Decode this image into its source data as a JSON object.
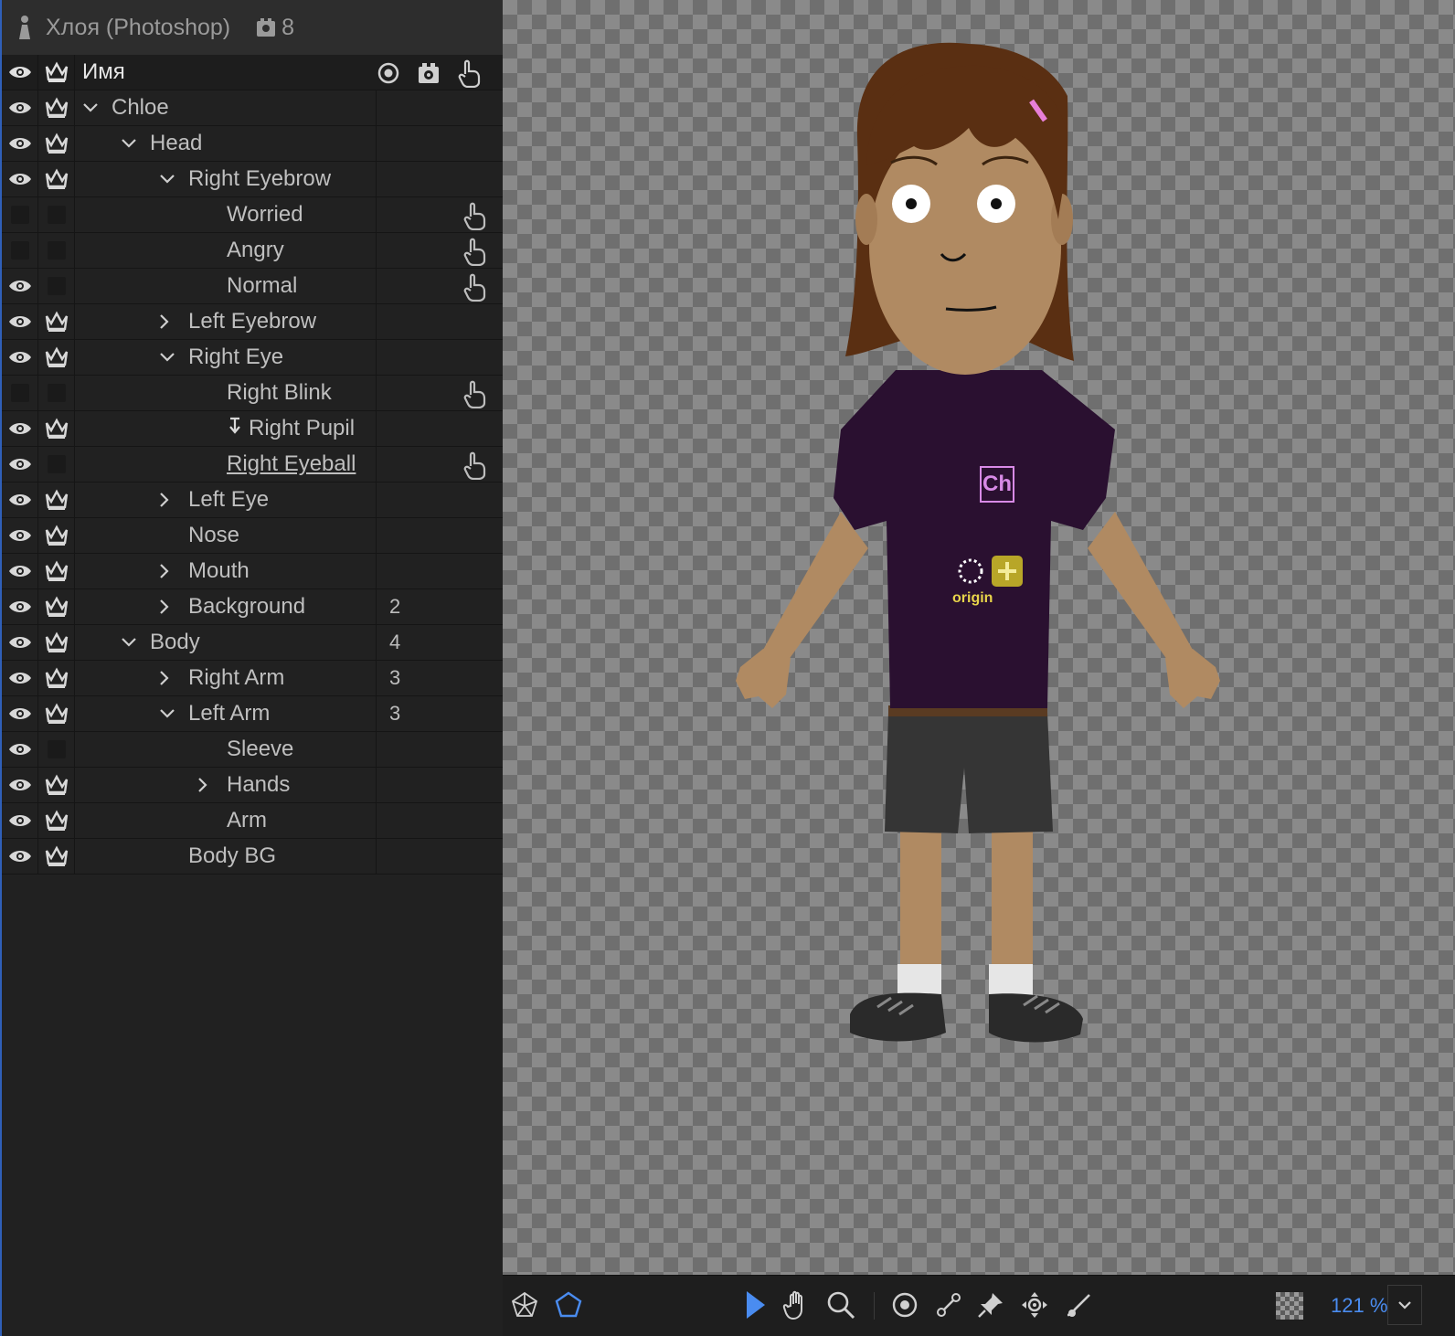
{
  "header": {
    "title": "Хлоя (Photoshop)",
    "count": "8"
  },
  "columns": {
    "name": "Имя"
  },
  "rows": [
    {
      "label": "Chloe",
      "indent": 0,
      "chevron": "down",
      "eye": true,
      "crown": true,
      "num": "",
      "handle": false
    },
    {
      "label": "Head",
      "indent": 1,
      "chevron": "down",
      "eye": true,
      "crown": true,
      "num": "",
      "handle": false
    },
    {
      "label": "Right Eyebrow",
      "indent": 2,
      "chevron": "down",
      "eye": true,
      "crown": true,
      "num": "",
      "handle": false
    },
    {
      "label": "Worried",
      "indent": 3,
      "chevron": "",
      "eye": false,
      "crown": false,
      "num": "",
      "handle": true
    },
    {
      "label": "Angry",
      "indent": 3,
      "chevron": "",
      "eye": false,
      "crown": false,
      "num": "",
      "handle": true
    },
    {
      "label": "Normal",
      "indent": 3,
      "chevron": "",
      "eye": true,
      "crown": false,
      "num": "",
      "handle": true
    },
    {
      "label": "Left Eyebrow",
      "indent": 2,
      "chevron": "right",
      "eye": true,
      "crown": true,
      "num": "",
      "handle": false
    },
    {
      "label": "Right Eye",
      "indent": 2,
      "chevron": "down",
      "eye": true,
      "crown": true,
      "num": "",
      "handle": false
    },
    {
      "label": "Right Blink",
      "indent": 3,
      "chevron": "",
      "eye": false,
      "crown": false,
      "num": "",
      "handle": true
    },
    {
      "label": "Right Pupil",
      "indent": 3,
      "chevron": "",
      "eye": true,
      "crown": true,
      "num": "",
      "handle": false,
      "arrow": true
    },
    {
      "label": "Right Eyeball",
      "indent": 3,
      "chevron": "",
      "eye": true,
      "crown": false,
      "num": "",
      "handle": true,
      "underline": true
    },
    {
      "label": "Left Eye",
      "indent": 2,
      "chevron": "right",
      "eye": true,
      "crown": true,
      "num": "",
      "handle": false
    },
    {
      "label": "Nose",
      "indent": 2,
      "chevron": "",
      "eye": true,
      "crown": true,
      "num": "",
      "handle": false
    },
    {
      "label": "Mouth",
      "indent": 2,
      "chevron": "right",
      "eye": true,
      "crown": true,
      "num": "",
      "handle": false
    },
    {
      "label": "Background",
      "indent": 2,
      "chevron": "right",
      "eye": true,
      "crown": true,
      "num": "2",
      "handle": false
    },
    {
      "label": "Body",
      "indent": 1,
      "chevron": "down",
      "eye": true,
      "crown": true,
      "num": "4",
      "handle": false
    },
    {
      "label": "Right Arm",
      "indent": 2,
      "chevron": "right",
      "eye": true,
      "crown": true,
      "num": "3",
      "handle": false
    },
    {
      "label": "Left Arm",
      "indent": 2,
      "chevron": "down",
      "eye": true,
      "crown": true,
      "num": "3",
      "handle": false
    },
    {
      "label": "Sleeve",
      "indent": 3,
      "chevron": "",
      "eye": true,
      "crown": false,
      "num": "",
      "handle": false
    },
    {
      "label": "Hands",
      "indent": 3,
      "chevron": "right",
      "eye": true,
      "crown": true,
      "num": "",
      "handle": false
    },
    {
      "label": "Arm",
      "indent": 3,
      "chevron": "",
      "eye": true,
      "crown": true,
      "num": "",
      "handle": false
    },
    {
      "label": "Body BG",
      "indent": 2,
      "chevron": "",
      "eye": true,
      "crown": true,
      "num": "",
      "handle": false
    }
  ],
  "canvas": {
    "badge": "Ch",
    "origin_label": "origin"
  },
  "toolbar": {
    "tools": [
      "mesh-tool-icon",
      "polygon-tool-icon",
      "select-arrow-icon",
      "hand-icon",
      "zoom-icon",
      "origin-tool-icon",
      "stick-tool-icon",
      "pin-tool-icon",
      "dragger-tool-icon",
      "draw-tool-icon"
    ],
    "zoom": "121 %"
  },
  "colors": {
    "accent": "#4a8cf0",
    "shirt": "#2a1030",
    "badge": "#d88ae6",
    "origin": "#e8d44a"
  }
}
